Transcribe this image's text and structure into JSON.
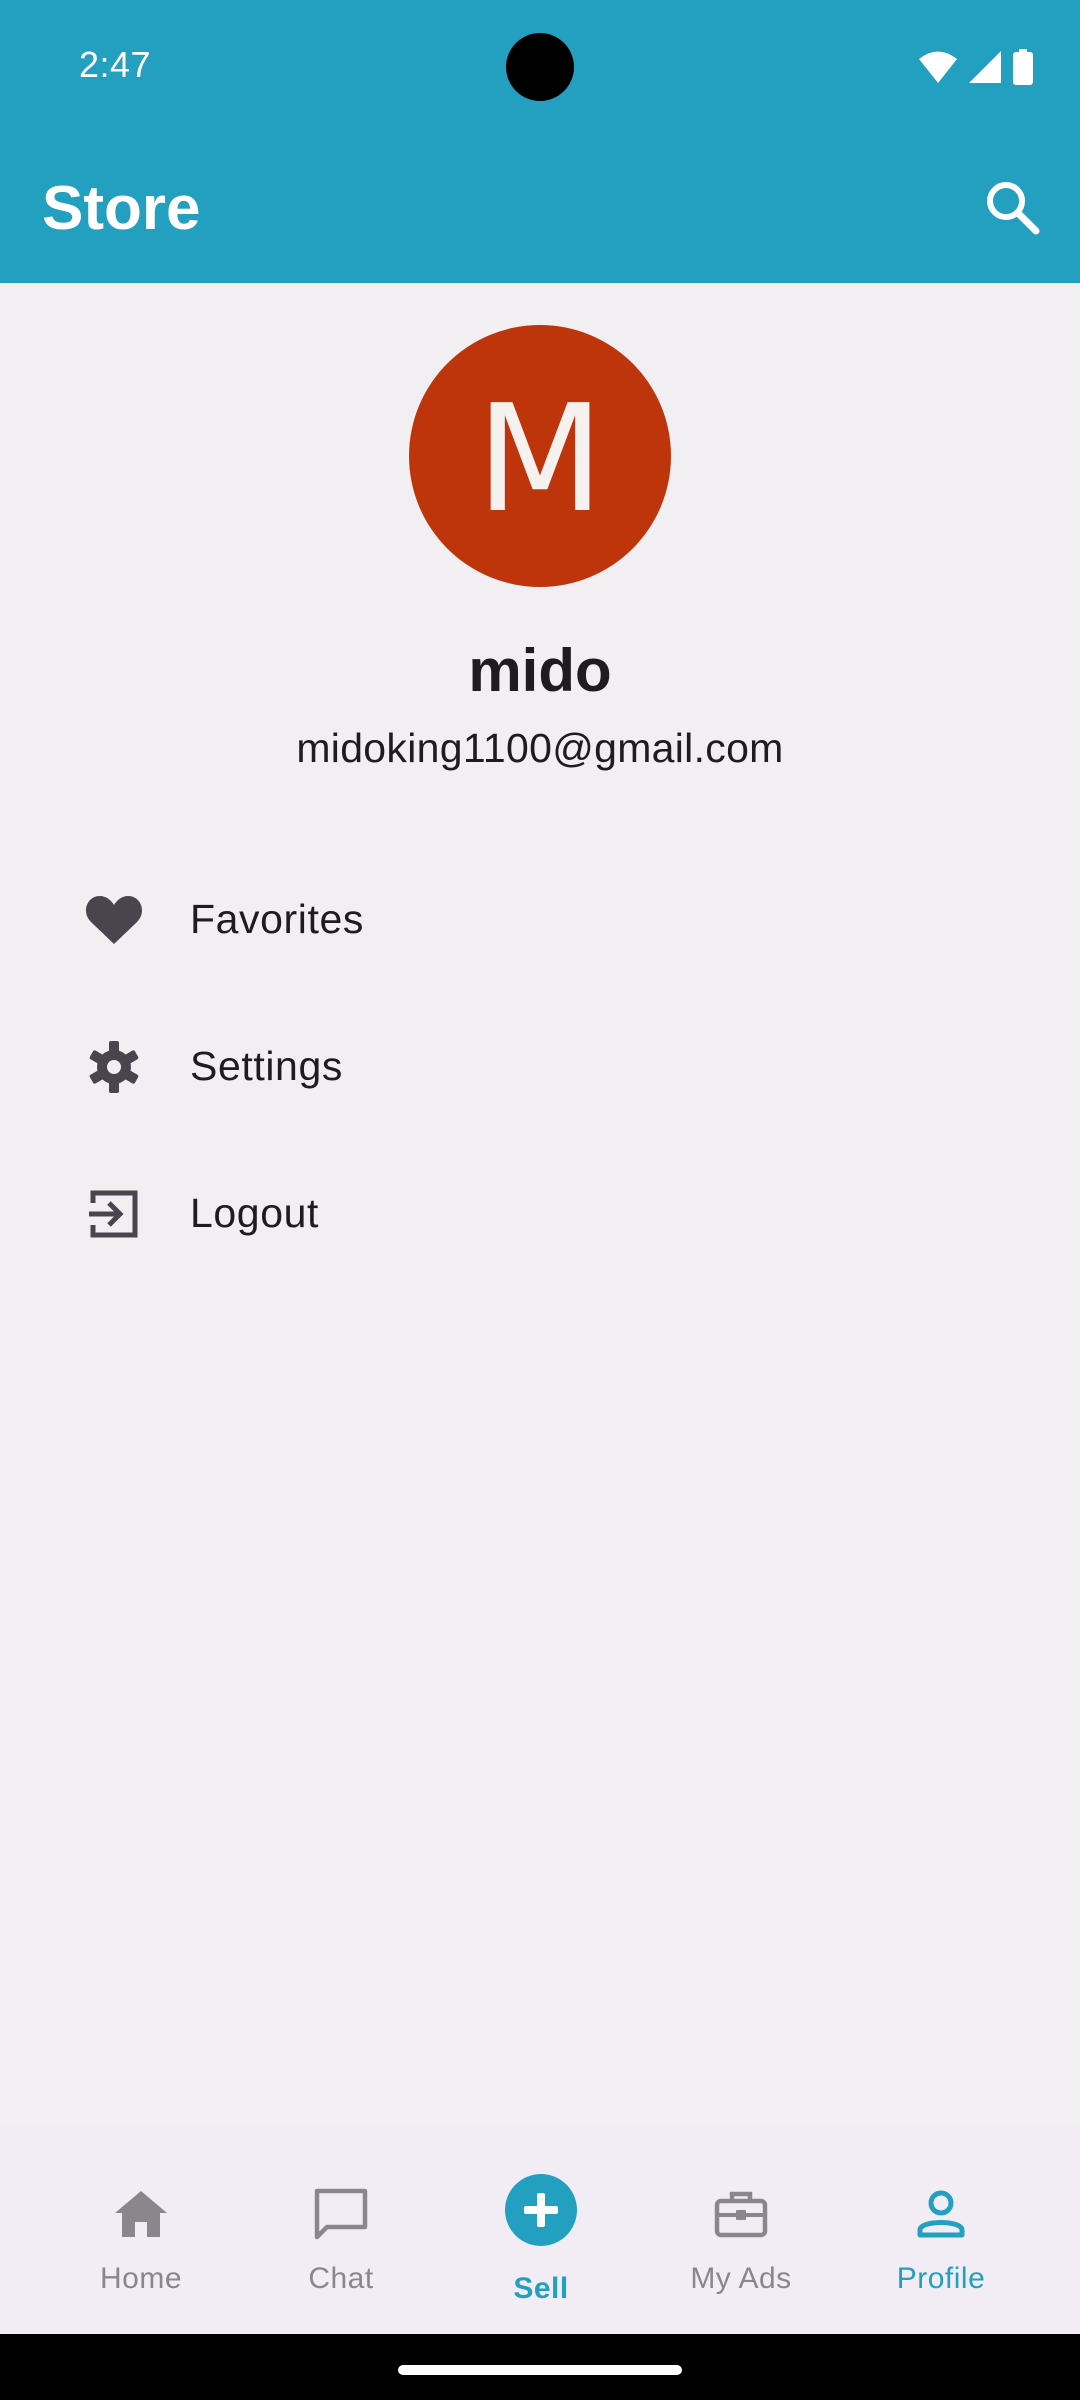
{
  "status_bar": {
    "time": "2:47",
    "icons": [
      "wifi-icon",
      "signal-icon",
      "battery-icon"
    ]
  },
  "app_bar": {
    "title": "Store",
    "action_icon": "search-icon"
  },
  "profile": {
    "avatar_letter": "M",
    "name": "mido",
    "email": "midoking1100@gmail.com"
  },
  "menu": {
    "items": [
      {
        "label": "Favorites",
        "icon": "heart-icon"
      },
      {
        "label": "Settings",
        "icon": "gear-icon"
      },
      {
        "label": "Logout",
        "icon": "logout-icon"
      }
    ]
  },
  "bottom_nav": {
    "items": [
      {
        "label": "Home",
        "icon": "home-icon",
        "active": false
      },
      {
        "label": "Chat",
        "icon": "chat-icon",
        "active": false
      },
      {
        "label": "Sell",
        "icon": "plus-icon",
        "active": false
      },
      {
        "label": "My Ads",
        "icon": "briefcase-icon",
        "active": false
      },
      {
        "label": "Profile",
        "icon": "person-icon",
        "active": true
      }
    ]
  },
  "colors": {
    "primary": "#239fc0",
    "avatar_bg": "#be350c",
    "background": "#f1eff2",
    "nav_bg": "#f2edf5",
    "text": "#1e1c20",
    "inactive": "#8a878c"
  }
}
